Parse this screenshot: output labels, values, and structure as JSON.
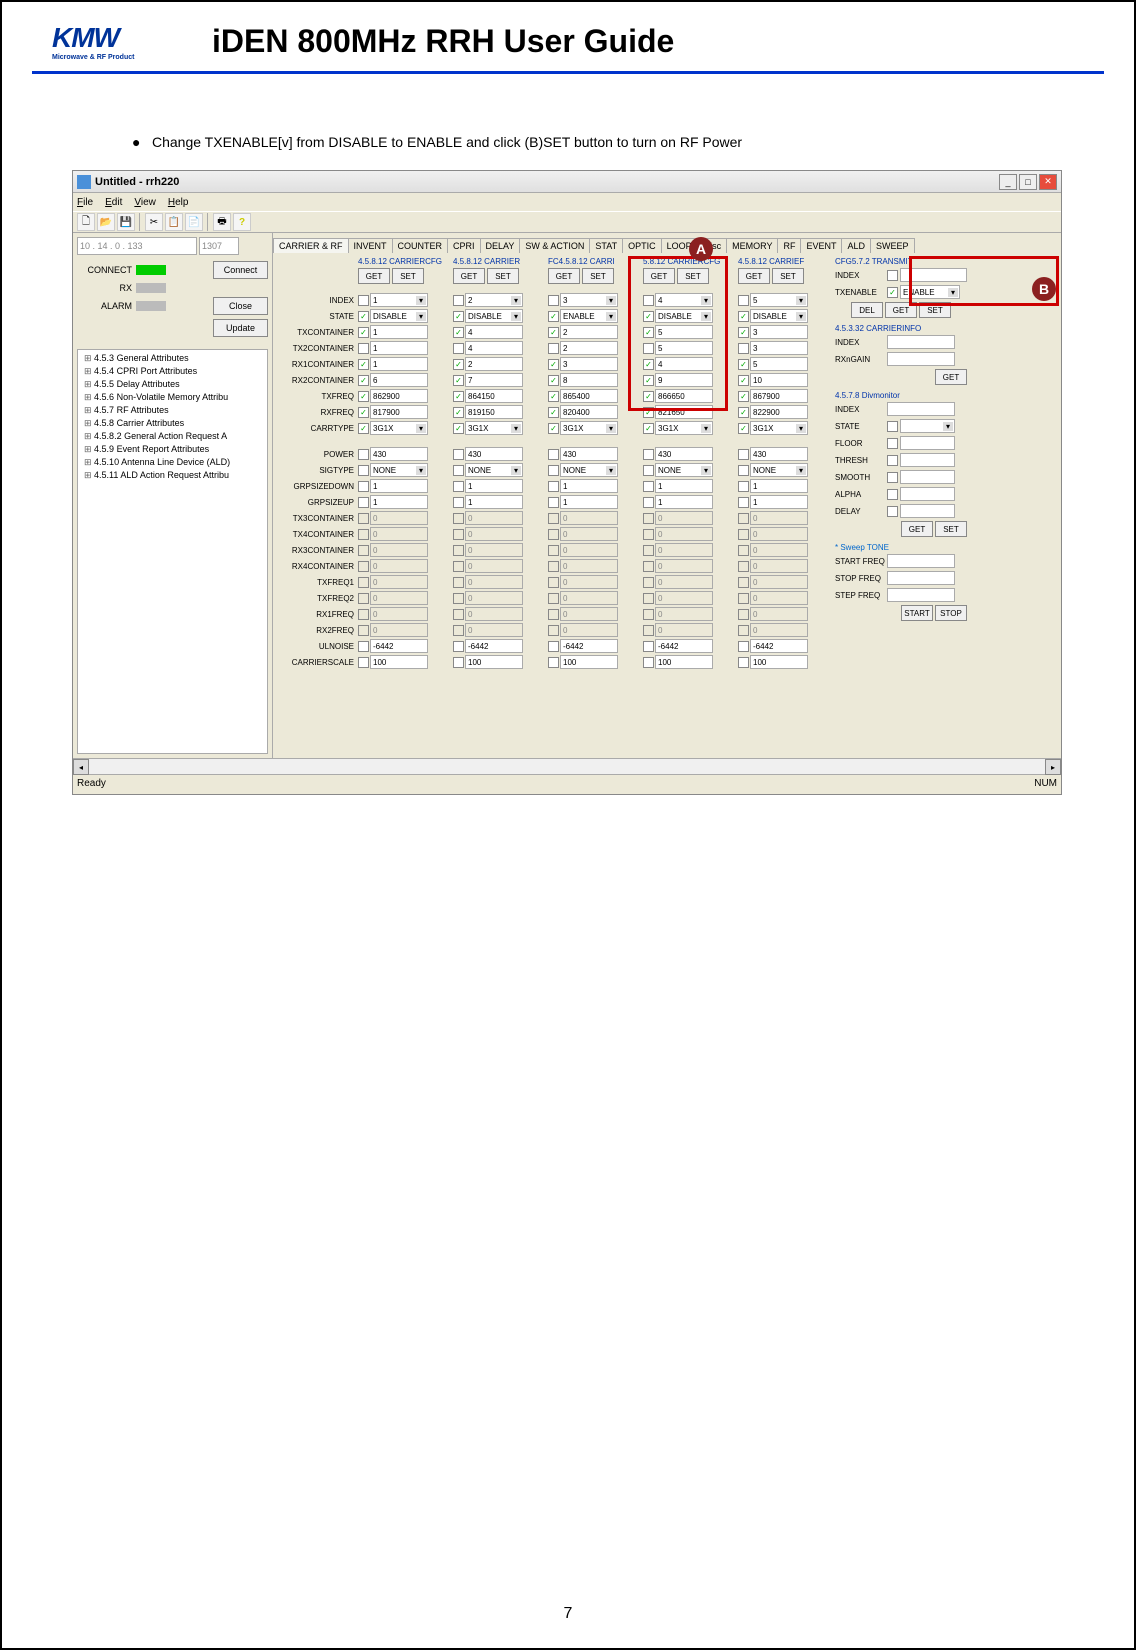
{
  "doc": {
    "logo": "KMW",
    "logo_sub": "Microwave & RF Product",
    "title": "iDEN 800MHz RRH User Guide",
    "instruction": "Change TXENABLE[v] from DISABLE to ENABLE and click (B)SET button to turn on RF Power",
    "page": "7"
  },
  "app": {
    "window_title": "Untitled - rrh220",
    "menus": [
      "File",
      "Edit",
      "View",
      "Help"
    ],
    "status_ready": "Ready",
    "status_num": "NUM"
  },
  "left": {
    "ip": "10  . 14  .  0  . 133",
    "port": "1307",
    "connect_label": "CONNECT",
    "rx_label": "RX",
    "alarm_label": "ALARM",
    "btn_connect": "Connect",
    "btn_close": "Close",
    "btn_update": "Update",
    "tree": [
      "4.5.3 General Attributes",
      "4.5.4 CPRI Port Attributes",
      "4.5.5 Delay Attributes",
      "4.5.6 Non-Volatile Memory Attribu",
      "4.5.7 RF Attributes",
      "4.5.8 Carrier Attributes",
      "4.5.8.2 General Action Request A",
      "4.5.9 Event Report Attributes",
      "4.5.10 Antenna Line Device (ALD)",
      "4.5.11 ALD Action Request Attribu"
    ]
  },
  "tabs": [
    "CARRIER & RF",
    "INVENT",
    "COUNTER",
    "CPRI",
    "DELAY",
    "SW & ACTION",
    "STAT",
    "OPTIC",
    "LOOP",
    "Misc",
    "MEMORY",
    "RF",
    "EVENT",
    "ALD",
    "SWEEP"
  ],
  "row_labels": [
    "INDEX",
    "STATE",
    "TXCONTAINER",
    "TX2CONTAINER",
    "RX1CONTAINER",
    "RX2CONTAINER",
    "TXFREQ",
    "RXFREQ",
    "CARRTYPE",
    "",
    "POWER",
    "SIGTYPE",
    "GRPSIZEDOWN",
    "GRPSIZEUP",
    "TX3CONTAINER",
    "TX4CONTAINER",
    "RX3CONTAINER",
    "RX4CONTAINER",
    "TXFREQ1",
    "TXFREQ2",
    "RX1FREQ",
    "RX2FREQ",
    "ULNOISE",
    "CARRIERSCALE"
  ],
  "columns": [
    {
      "hdr": "4.5.8.12 CARRIERCFG",
      "get": "GET",
      "set": "SET",
      "index": "1",
      "state": "DISABLE",
      "txc": "1",
      "tx2c": "1",
      "rx1c": "1",
      "rx2c": "6",
      "txf": "862900",
      "rxf": "817900",
      "ct": "3G1X",
      "power": "430",
      "sig": "NONE",
      "gd": "1",
      "gu": "1",
      "tx3": "0",
      "tx4": "0",
      "rx3": "0",
      "rx4": "0",
      "tf1": "0",
      "tf2": "0",
      "r1f": "0",
      "r2f": "0",
      "uln": "-6442",
      "cs": "100"
    },
    {
      "hdr": "4.5.8.12 CARRIER",
      "get": "GET",
      "set": "SET",
      "index": "2",
      "state": "DISABLE",
      "txc": "4",
      "tx2c": "4",
      "rx1c": "2",
      "rx2c": "7",
      "txf": "864150",
      "rxf": "819150",
      "ct": "3G1X",
      "power": "430",
      "sig": "NONE",
      "gd": "1",
      "gu": "1",
      "tx3": "0",
      "tx4": "0",
      "rx3": "0",
      "rx4": "0",
      "tf1": "0",
      "tf2": "0",
      "r1f": "0",
      "r2f": "0",
      "uln": "-6442",
      "cs": "100"
    },
    {
      "hdr": "FC4.5.8.12 CARRI",
      "get": "GET",
      "set": "SET",
      "index": "3",
      "state": "ENABLE",
      "txc": "2",
      "tx2c": "2",
      "rx1c": "3",
      "rx2c": "8",
      "txf": "865400",
      "rxf": "820400",
      "ct": "3G1X",
      "power": "430",
      "sig": "NONE",
      "gd": "1",
      "gu": "1",
      "tx3": "0",
      "tx4": "0",
      "rx3": "0",
      "rx4": "0",
      "tf1": "0",
      "tf2": "0",
      "r1f": "0",
      "r2f": "0",
      "uln": "-6442",
      "cs": "100"
    },
    {
      "hdr": "5.8.12 CARRIERCFG",
      "get": "GET",
      "set": "SET",
      "index": "4",
      "state": "DISABLE",
      "txc": "5",
      "tx2c": "5",
      "rx1c": "4",
      "rx2c": "9",
      "txf": "866650",
      "rxf": "821650",
      "ct": "3G1X",
      "power": "430",
      "sig": "NONE",
      "gd": "1",
      "gu": "1",
      "tx3": "0",
      "tx4": "0",
      "rx3": "0",
      "rx4": "0",
      "tf1": "0",
      "tf2": "0",
      "r1f": "0",
      "r2f": "0",
      "uln": "-6442",
      "cs": "100"
    },
    {
      "hdr": "4.5.8.12 CARRIEF",
      "get": "GET",
      "set": "SET",
      "index": "5",
      "state": "DISABLE",
      "txc": "3",
      "tx2c": "3",
      "rx1c": "5",
      "rx2c": "10",
      "txf": "867900",
      "rxf": "822900",
      "ct": "3G1X",
      "power": "430",
      "sig": "NONE",
      "gd": "1",
      "gu": "1",
      "tx3": "0",
      "tx4": "0",
      "rx3": "0",
      "rx4": "0",
      "tf1": "0",
      "tf2": "0",
      "r1f": "0",
      "r2f": "0",
      "uln": "-6442",
      "cs": "100"
    }
  ],
  "transmit": {
    "hdr": "CFG5.7.2 TRANSMIT",
    "index_label": "INDEX",
    "txen_label": "TXENABLE",
    "txen_val": "ENABLE",
    "del": "DEL",
    "get": "GET",
    "set": "SET"
  },
  "carrierinfo": {
    "hdr": "4.5.3.32 CARRIERINFO",
    "index": "INDEX",
    "rxngain": "RXnGAIN",
    "get": "GET"
  },
  "divmon": {
    "hdr": "4.5.7.8 Divmonitor",
    "index": "INDEX",
    "state": "STATE",
    "floor": "FLOOR",
    "thresh": "THRESH",
    "smooth": "SMOOTH",
    "alpha": "ALPHA",
    "delay": "DELAY",
    "get": "GET",
    "set": "SET"
  },
  "sweep": {
    "hdr": "* Sweep TONE",
    "start_freq": "START FREQ",
    "stop_freq": "STOP FREQ",
    "step_freq": "STEP FREQ",
    "start": "START",
    "stop": "STOP"
  },
  "markers": {
    "A": "A",
    "B": "B"
  }
}
